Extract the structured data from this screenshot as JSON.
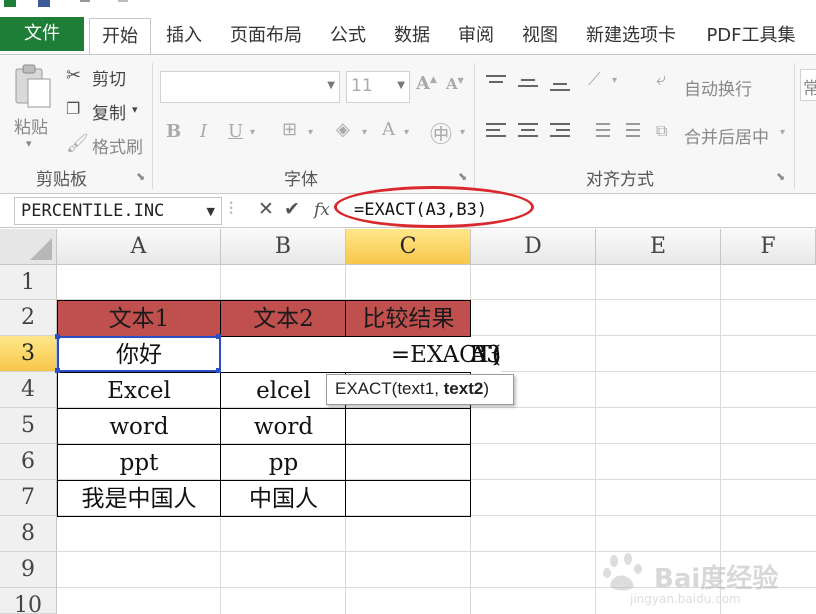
{
  "ribbon_tabs": {
    "file": "文件",
    "home": "开始",
    "insert": "插入",
    "page_layout": "页面布局",
    "formulas": "公式",
    "data": "数据",
    "review": "审阅",
    "view": "视图",
    "new_tab": "新建选项卡",
    "pdf": "PDF工具集"
  },
  "clipboard": {
    "paste": "粘贴",
    "cut": "剪切",
    "copy": "复制",
    "format_painter": "格式刷",
    "group_label": "剪贴板"
  },
  "font": {
    "font_name": "",
    "font_size": "11",
    "group_label": "字体"
  },
  "alignment": {
    "wrap_text": "自动换行",
    "merge_center": "合并后居中",
    "group_label": "对齐方式"
  },
  "number": {
    "format_partial": "常"
  },
  "formula_bar": {
    "name_box": "PERCENTILE.INC",
    "cancel": "✕",
    "enter": "✔",
    "fx": "fx",
    "formula": "=EXACT(A3,B3)"
  },
  "columns": [
    "A",
    "B",
    "C",
    "D",
    "E",
    "F"
  ],
  "rows": [
    "1",
    "2",
    "3",
    "4",
    "5",
    "6",
    "7",
    "8",
    "9",
    "10"
  ],
  "cells": {
    "A2": "文本1",
    "B2": "文本2",
    "C2": "比较结果",
    "A3": "你好",
    "A4": "Excel",
    "B4": "elcel",
    "A5": "word",
    "B5": "word",
    "A6": "ppt",
    "B6": "pp",
    "A7": "我是中国人",
    "B7": "中国人"
  },
  "edit_cell": {
    "prefix": "=EXACT(",
    "ref1": "A3",
    "comma": ",",
    "ref2": "B3",
    "suffix": ")"
  },
  "tooltip": {
    "func": "EXACT(text1, ",
    "current_arg": "text2",
    "close": ")"
  },
  "watermark": {
    "brand": "Bai度经验",
    "url": "jingyan.baidu.com"
  },
  "colors": {
    "file_tab": "#1e7d36",
    "header_fill": "#c0504d",
    "selected_header": "#f7c64a",
    "annotation_ellipse": "#d9292f",
    "ref1_color": "#3a56d4",
    "ref2_color": "#1f8b2e"
  }
}
